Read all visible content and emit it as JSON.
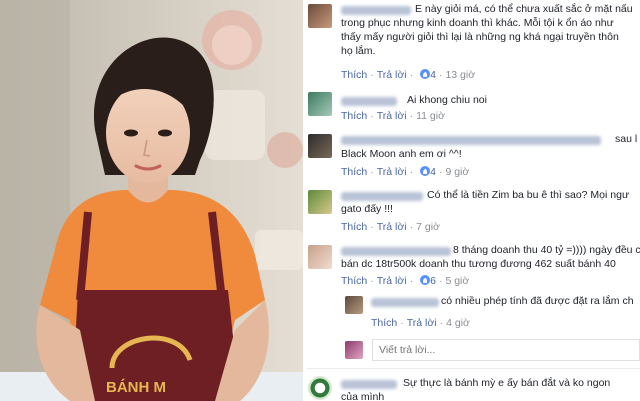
{
  "comments": [
    {
      "lines": [
        "E này giỏi má, có thể chưa xuất sắc ở mặt nấu",
        "trong phục nhưng kinh doanh thì khác. Mỗi tội k ổn áo như",
        "thấy mấy người giỏi thì lại là những ng khá ngại truyền thôn",
        "họ lắm."
      ],
      "reply": "Thích",
      "reply2": "Trả lời",
      "likes": "4",
      "time": "13 giờ"
    },
    {
      "lines": [
        "Ai khong chiu noi"
      ],
      "reply": "Thích",
      "reply2": "Trả lời",
      "time": "11 giờ"
    },
    {
      "lines": [
        "sau l",
        "Black Moon anh em ơi ^^!"
      ],
      "reply": "Thích",
      "reply2": "Trả lời",
      "likes": "4",
      "time": "9 giờ"
    },
    {
      "lines": [
        "Có thể là tiền Zim ba bu ê thì sao? Mọi ngư",
        "gato đấy !!!"
      ],
      "reply": "Thích",
      "reply2": "Trả lời",
      "time": "7 giờ"
    },
    {
      "lines": [
        "8 tháng doanh thu 40 tỷ =)))) ngày đều c",
        "bán dc 18tr500k doanh thu tương đương 462 suất bánh 40"
      ],
      "reply": "Thích",
      "reply2": "Trả lời",
      "likes": "6",
      "time": "5 giờ"
    },
    {
      "lines": [
        "có nhiều phép tính đã được đặt ra lắm ch"
      ],
      "reply": "Thích",
      "reply2": "Trả lời",
      "time": "4 giờ"
    },
    {
      "lines": [
        "Sự thực là bánh mỳ e ấy bán đắt và ko ngon",
        "của mình"
      ]
    }
  ],
  "reply_placeholder": "Viết trả lời...",
  "photo": {
    "apron_logo_text": "BÁNH M"
  },
  "colors": {
    "link": "#4b67a1",
    "meta": "#8a8d91",
    "text": "#1d2129",
    "shirt": "#f08a3c",
    "apron": "#6e1f23"
  }
}
